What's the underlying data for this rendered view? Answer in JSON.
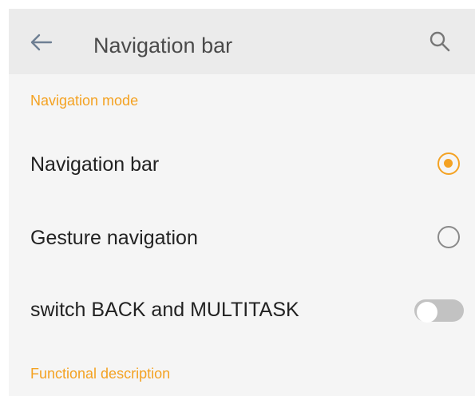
{
  "app_bar": {
    "title": "Navigation bar",
    "back_icon": "arrow-left-icon",
    "search_icon": "search-icon"
  },
  "sections": {
    "navigation_mode": {
      "header": "Navigation mode",
      "options": [
        {
          "label": "Navigation bar",
          "selected": true
        },
        {
          "label": "Gesture navigation",
          "selected": false
        }
      ]
    },
    "swap_setting": {
      "label": "switch BACK and MULTITASK",
      "enabled": false
    },
    "functional_description": {
      "header": "Functional description"
    }
  },
  "colors": {
    "accent": "#f4a222",
    "app_bar_bg": "#ebebeb",
    "background": "#f5f5f5",
    "toggle_off": "#c2c2c2"
  }
}
